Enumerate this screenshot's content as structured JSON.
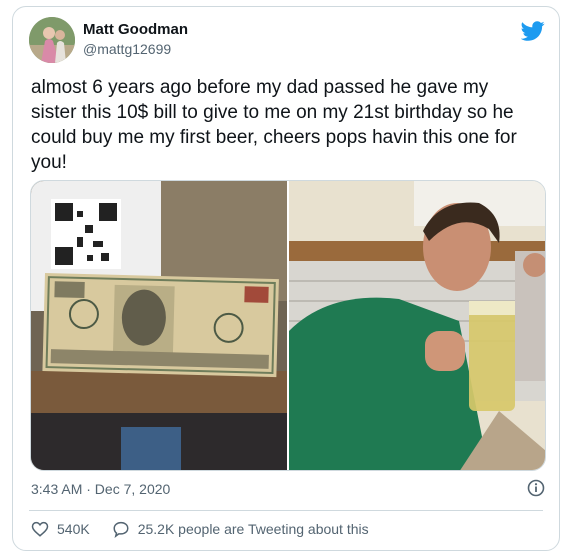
{
  "author": {
    "name": "Matt Goodman",
    "handle": "@mattg12699"
  },
  "tweet": {
    "text": "almost 6 years ago before my dad passed he gave my sister this 10$ bill to give to me on my 21st birthday so he could buy me my first beer, cheers pops havin this one for you!",
    "timestamp": "3:43 AM · Dec 7, 2020"
  },
  "stats": {
    "likes": "540K",
    "tweeting": "25.2K people are Tweeting about this"
  },
  "icons": {
    "brand": "twitter-bird-icon",
    "info": "info-icon",
    "like": "heart-icon",
    "reply": "speech-bubble-icon"
  },
  "colors": {
    "brand_blue": "#1d9bf0",
    "text": "#0f1419",
    "muted": "#536471",
    "border": "#cfd9de"
  }
}
